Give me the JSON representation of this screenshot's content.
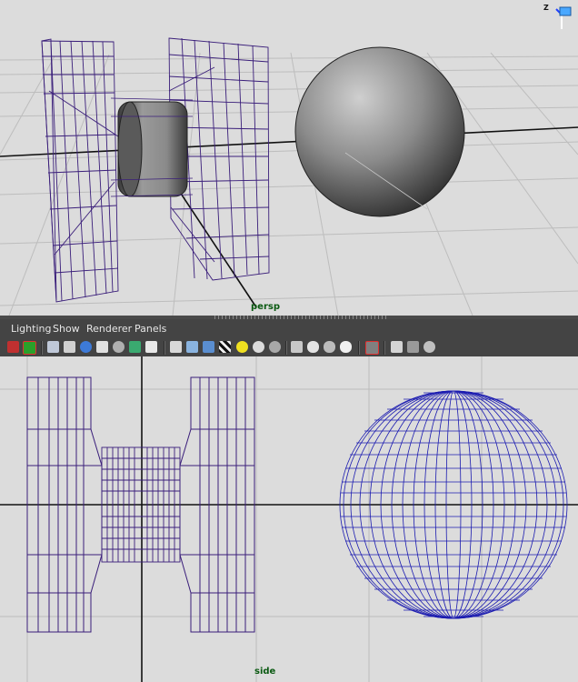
{
  "viewports": {
    "top": {
      "camera_label": "persp",
      "axis_indicator": "Z"
    },
    "bottom": {
      "camera_label": "side"
    }
  },
  "panel_menu": {
    "items": [
      {
        "label": "Lighting"
      },
      {
        "label": "Show"
      },
      {
        "label": "Renderer"
      },
      {
        "label": "Panels"
      }
    ]
  },
  "toolbar": {
    "icons": [
      "select-camera-icon",
      "camera-attributes-icon",
      "image-plane-icon",
      "grid-icon",
      "film-gate-icon",
      "resolution-gate-icon",
      "safe-action-icon",
      "safe-title-icon",
      "wireframe-icon",
      "smooth-shade-icon",
      "wireframe-on-shaded-icon",
      "textured-icon",
      "use-all-lights-icon",
      "shadows-icon",
      "flat-light-icon",
      "default-light-icon",
      "xray-icon",
      "xray-joints-icon",
      "backface-cull-icon",
      "high-quality-icon",
      "isolate-select-icon",
      "bookmark-icon",
      "xray-components-icon",
      "share-icon"
    ]
  },
  "colors": {
    "wireframe_purple": "#3a1e7a",
    "wireframe_blue": "#1b1bb0",
    "camera_label_green": "#0b5a12",
    "grid_axis": "#101010",
    "viewport_bg": "#dcdcdc",
    "panel_bar": "#444444"
  }
}
